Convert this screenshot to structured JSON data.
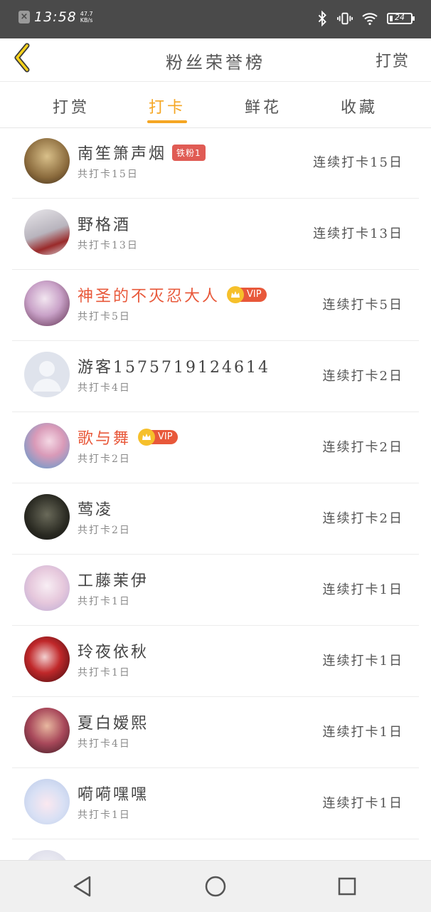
{
  "status_bar": {
    "time": "13:58",
    "net_speed_value": "47.7",
    "net_speed_unit": "KB/s",
    "battery": "24"
  },
  "header": {
    "title": "粉丝荣誉榜",
    "action_label": "打赏"
  },
  "tabs": [
    {
      "label": "打赏",
      "active": false
    },
    {
      "label": "打卡",
      "active": true
    },
    {
      "label": "鲜花",
      "active": false
    },
    {
      "label": "收藏",
      "active": false
    }
  ],
  "colors": {
    "accent": "#f5a623",
    "vip_name": "#e8583a",
    "fan_badge": "#e05b54"
  },
  "users": [
    {
      "name": "南笙箫声烟",
      "badge": "铁粉1",
      "vip": false,
      "vip_label": "",
      "total": "共打卡15日",
      "streak": "连续打卡15日"
    },
    {
      "name": "野格酒",
      "badge": "",
      "vip": false,
      "vip_label": "",
      "total": "共打卡13日",
      "streak": "连续打卡13日"
    },
    {
      "name": "神圣的不灭忍大人",
      "badge": "",
      "vip": true,
      "vip_label": "VIP",
      "total": "共打卡5日",
      "streak": "连续打卡5日"
    },
    {
      "name": "游客1575719124614",
      "badge": "",
      "vip": false,
      "vip_label": "",
      "total": "共打卡4日",
      "streak": "连续打卡2日"
    },
    {
      "name": "歌与舞",
      "badge": "",
      "vip": true,
      "vip_label": "VIP",
      "total": "共打卡2日",
      "streak": "连续打卡2日"
    },
    {
      "name": "莺凌",
      "badge": "",
      "vip": false,
      "vip_label": "",
      "total": "共打卡2日",
      "streak": "连续打卡2日"
    },
    {
      "name": "工藤茉伊",
      "badge": "",
      "vip": false,
      "vip_label": "",
      "total": "共打卡1日",
      "streak": "连续打卡1日"
    },
    {
      "name": "玲夜依秋",
      "badge": "",
      "vip": false,
      "vip_label": "",
      "total": "共打卡1日",
      "streak": "连续打卡1日"
    },
    {
      "name": "夏白嫒熙",
      "badge": "",
      "vip": false,
      "vip_label": "",
      "total": "共打卡4日",
      "streak": "连续打卡1日"
    },
    {
      "name": "嗬嗬嘿嘿",
      "badge": "",
      "vip": false,
      "vip_label": "",
      "total": "共打卡1日",
      "streak": "连续打卡1日"
    }
  ]
}
